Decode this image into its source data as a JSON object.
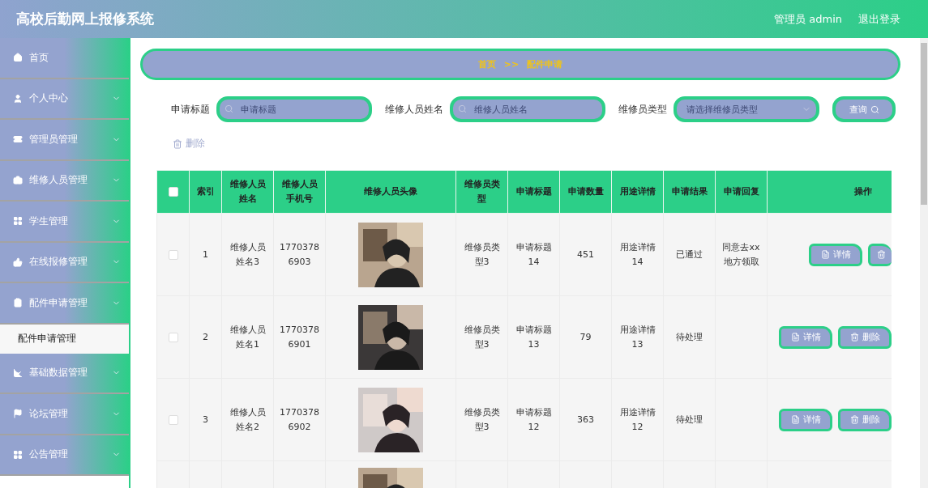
{
  "header": {
    "title": "高校后勤网上报修系统",
    "user": "管理员 admin",
    "logout": "退出登录"
  },
  "sidebar": {
    "items": [
      {
        "label": "首页",
        "kind": "link"
      },
      {
        "label": "个人中心",
        "kind": "menu"
      },
      {
        "label": "管理员管理",
        "kind": "menu"
      },
      {
        "label": "维修人员管理",
        "kind": "menu"
      },
      {
        "label": "学生管理",
        "kind": "menu"
      },
      {
        "label": "在线报修管理",
        "kind": "menu"
      },
      {
        "label": "配件申请管理",
        "kind": "menu",
        "children": [
          {
            "label": "配件申请管理",
            "selected": true
          }
        ]
      },
      {
        "label": "基础数据管理",
        "kind": "menu"
      },
      {
        "label": "论坛管理",
        "kind": "menu"
      },
      {
        "label": "公告管理",
        "kind": "menu"
      }
    ]
  },
  "breadcrumb": {
    "home": "首页",
    "separator": ">>",
    "current": "配件申请"
  },
  "filters": [
    {
      "kind": "input",
      "label": "申请标题",
      "placeholder": "申请标题"
    },
    {
      "kind": "input",
      "label": "维修人员姓名",
      "placeholder": "维修人员姓名"
    },
    {
      "kind": "select",
      "label": "维修员类型",
      "placeholder": "请选择维修员类型"
    }
  ],
  "search_button": "查询",
  "delete_button": "删除",
  "table": {
    "columns": [
      "索引",
      "维修人员姓名",
      "维修人员手机号",
      "维修人员头像",
      "维修员类型",
      "申请标题",
      "申请数量",
      "用途详情",
      "申请结果",
      "申请回复",
      "操作"
    ],
    "header_checked": false,
    "rows": [
      {
        "kind": "full",
        "checked": false,
        "cells": [
          "1",
          "维修人员姓名3",
          "17703786903",
          {
            "kind": "picture"
          },
          "维修员类型3",
          "申请标题14",
          "451",
          "用途详情14",
          "已通过",
          "同意去xx地方领取"
        ],
        "actions": [
          {
            "kind": "detail",
            "label": "详情"
          },
          {
            "kind": "delete"
          }
        ]
      },
      {
        "kind": "full",
        "checked": false,
        "cells": [
          "2",
          "维修人员姓名1",
          "17703786901",
          {
            "kind": "picture"
          },
          "维修员类型3",
          "申请标题13",
          "79",
          "用途详情13",
          "待处理",
          ""
        ],
        "actions": [
          {
            "kind": "detail",
            "label": "详情"
          },
          {
            "kind": "delete",
            "label": "删除"
          }
        ]
      },
      {
        "kind": "full",
        "checked": false,
        "cells": [
          "3",
          "维修人员姓名2",
          "17703786902",
          {
            "kind": "picture"
          },
          "维修员类型3",
          "申请标题12",
          "363",
          "用途详情12",
          "待处理",
          ""
        ],
        "actions": [
          {
            "kind": "detail",
            "label": "详情"
          },
          {
            "kind": "delete",
            "label": "删除"
          }
        ]
      },
      {
        "kind": "partial",
        "cells": [
          {
            "kind": "picture"
          }
        ]
      }
    ]
  }
}
